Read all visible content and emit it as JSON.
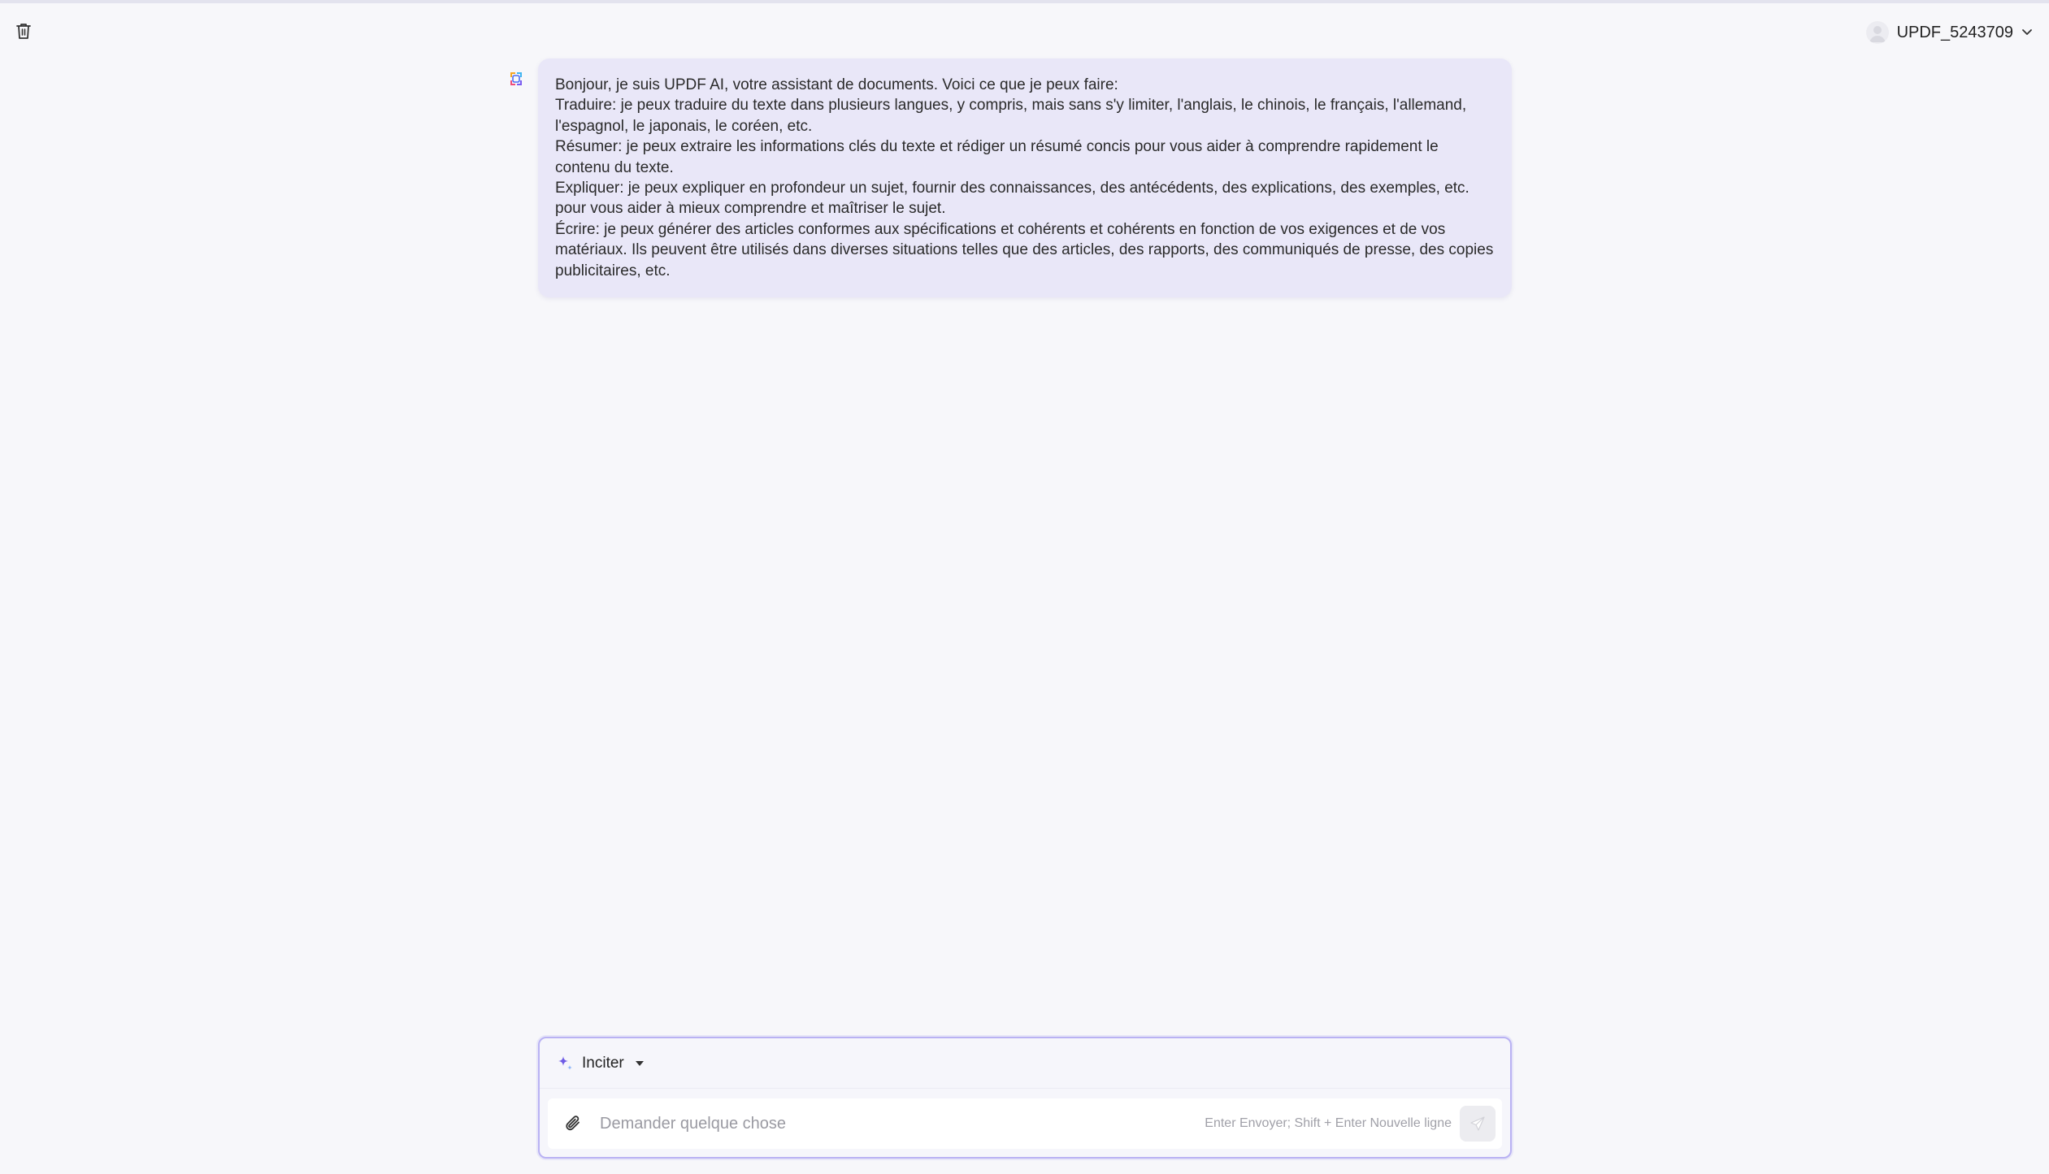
{
  "header": {
    "trash_icon": "trash-icon",
    "user": {
      "name": "UPDF_5243709",
      "avatar_icon": "user-avatar-icon",
      "dropdown_icon": "chevron-down-icon"
    }
  },
  "chat": {
    "assistant_icon": "updf-ai-logo-icon",
    "messages": [
      {
        "role": "assistant",
        "lines": [
          "Bonjour, je suis UPDF AI, votre assistant de documents. Voici ce que je peux faire:",
          "Traduire: je peux traduire du texte dans plusieurs langues, y compris, mais sans s'y limiter, l'anglais, le chinois, le français, l'allemand, l'espagnol, le japonais, le coréen, etc.",
          "Résumer: je peux extraire les informations clés du texte et rédiger un résumé concis pour vous aider à comprendre rapidement le contenu du texte.",
          "Expliquer: je peux expliquer en profondeur un sujet, fournir des connaissances, des antécédents, des explications, des exemples, etc. pour vous aider à mieux comprendre et maîtriser le sujet.",
          "Écrire: je peux générer des articles conformes aux spécifications et cohérents et cohérents en fonction de vos exigences et de vos matériaux. Ils peuvent être utilisés dans diverses situations telles que des articles, des rapports, des communiqués de presse, des copies publicitaires, etc."
        ]
      }
    ]
  },
  "composer": {
    "prompt_label": "Inciter",
    "prompt_icon": "sparkle-icon",
    "attach_icon": "paperclip-icon",
    "input_value": "",
    "input_placeholder": "Demander quelque chose",
    "hint": "Enter Envoyer; Shift + Enter Nouvelle ligne",
    "send_icon": "send-icon"
  },
  "colors": {
    "background": "#f7f7fa",
    "bubble": "#e9e7f8",
    "accent_border": "#b9b2f3",
    "sparkle": "#6f5ce6"
  }
}
